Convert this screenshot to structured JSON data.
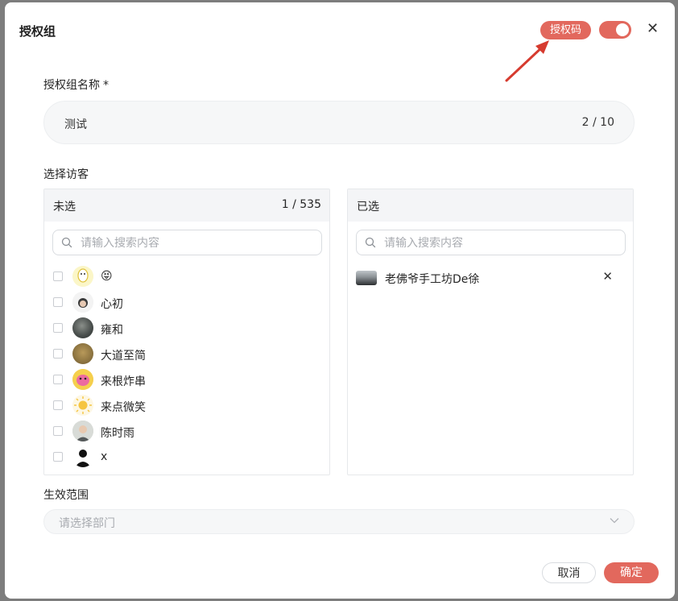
{
  "dialog": {
    "title": "授权组",
    "code_badge": "授权码",
    "toggle_on": true
  },
  "group_name": {
    "label": "授权组名称",
    "required_mark": "*",
    "value": "测试",
    "counter": "2 / 10"
  },
  "visitors": {
    "label": "选择访客",
    "unselected": {
      "title": "未选",
      "counter": "1 / 535",
      "search_placeholder": "请输入搜索内容",
      "items": [
        {
          "name": "😝"
        },
        {
          "name": "心初"
        },
        {
          "name": "雍和"
        },
        {
          "name": "大道至简"
        },
        {
          "name": "来根炸串"
        },
        {
          "name": "来点微笑"
        },
        {
          "name": "陈时雨"
        },
        {
          "name": "x"
        }
      ]
    },
    "selected": {
      "title": "已选",
      "search_placeholder": "请输入搜索内容",
      "items": [
        {
          "name": "老佛爷手工坊De徐"
        }
      ]
    }
  },
  "scope": {
    "label": "生效范围",
    "placeholder": "请选择部门"
  },
  "footer": {
    "cancel_label": "取消",
    "ok_label": "确定"
  },
  "colors": {
    "accent": "#e2685d",
    "arrow": "#d63b2f"
  },
  "icons": {
    "close": "close-icon",
    "search": "search-icon",
    "chevron": "chevron-down-icon",
    "remove": "remove-icon"
  }
}
